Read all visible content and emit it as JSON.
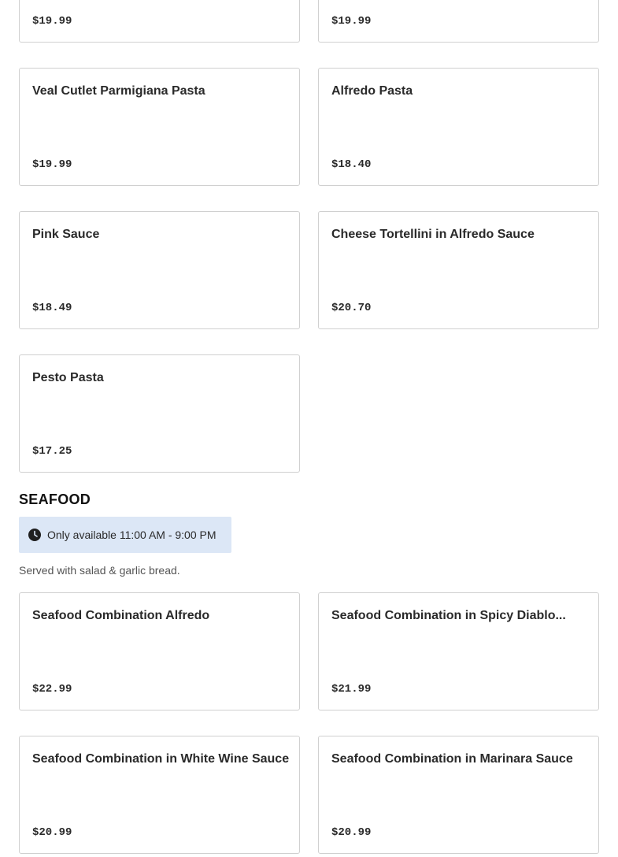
{
  "menu": {
    "top_items": [
      {
        "name": "",
        "price": "$19.99"
      },
      {
        "name": "",
        "price": "$19.99"
      },
      {
        "name": "Veal Cutlet Parmigiana Pasta",
        "price": "$19.99"
      },
      {
        "name": "Alfredo Pasta",
        "price": "$18.40"
      },
      {
        "name": "Pink Sauce",
        "price": "$18.49"
      },
      {
        "name": "Cheese Tortellini in Alfredo Sauce",
        "price": "$20.70"
      },
      {
        "name": "Pesto Pasta",
        "price": "$17.25"
      }
    ],
    "seafood": {
      "title": "SEAFOOD",
      "availability": "Only available 11:00 AM - 9:00 PM",
      "availability_icon": "clock-icon",
      "description": "Served with salad & garlic bread.",
      "items": [
        {
          "name": "Seafood Combination Alfredo",
          "price": "$22.99"
        },
        {
          "name": "Seafood Combination in Spicy Diablo...",
          "price": "$21.99"
        },
        {
          "name": "Seafood Combination in White Wine Sauce",
          "price": "$20.99"
        },
        {
          "name": "Seafood Combination in Marinara Sauce",
          "price": "$20.99"
        }
      ]
    }
  },
  "colors": {
    "card_border": "#d0d0d0",
    "availability_bg": "#dce7f6",
    "text": "#2a2a2a"
  }
}
